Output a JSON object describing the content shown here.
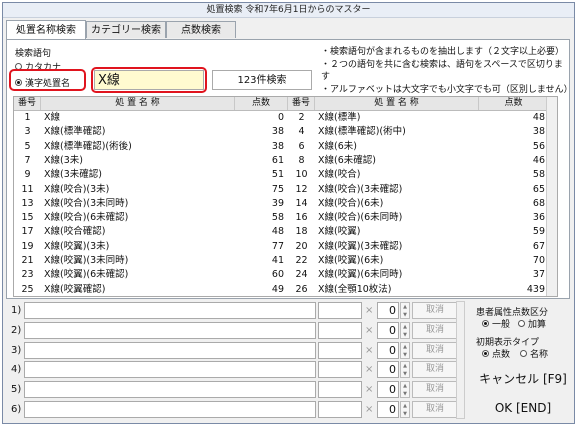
{
  "window": {
    "title": "処置検索 令和7年6月1日からのマスター"
  },
  "tabs": [
    {
      "label": "処置名称検索",
      "active": true
    },
    {
      "label": "カテゴリー検索",
      "active": false
    },
    {
      "label": "点数検索",
      "active": false
    }
  ],
  "search": {
    "group_label": "検索語句",
    "radio_katakana": "カタカナ",
    "radio_kanji": "漢字処置名",
    "query": "X線",
    "result_button": "123件検索"
  },
  "notes": [
    "・検索語句が含まれるものを抽出します（２文字以上必要）",
    "・２つの語句を共に含む検索は、語句をスペースで区切ります",
    "・アルファベットは大文字でも小文字でも可（区別しません）"
  ],
  "grid": {
    "headers": [
      "番号",
      "処 置 名 称",
      "点数",
      "番号",
      "処 置 名 称",
      "点数"
    ],
    "rows": [
      {
        "n1": "1",
        "name1": "X線",
        "p1": "0",
        "n2": "2",
        "name2": "X線(標準)",
        "p2": "48"
      },
      {
        "n1": "3",
        "name1": "X線(標準確認)",
        "p1": "38",
        "n2": "4",
        "name2": "X線(標準確認)(術中)",
        "p2": "38"
      },
      {
        "n1": "5",
        "name1": "X線(標準確認)(術後)",
        "p1": "38",
        "n2": "6",
        "name2": "X線(6未)",
        "p2": "56"
      },
      {
        "n1": "7",
        "name1": "X線(3未)",
        "p1": "61",
        "n2": "8",
        "name2": "X線(6未確認)",
        "p2": "46"
      },
      {
        "n1": "9",
        "name1": "X線(3未確認)",
        "p1": "51",
        "n2": "10",
        "name2": "X線(咬合)",
        "p2": "58"
      },
      {
        "n1": "11",
        "name1": "X線(咬合)(3未)",
        "p1": "75",
        "n2": "12",
        "name2": "X線(咬合)(3未確認)",
        "p2": "65"
      },
      {
        "n1": "13",
        "name1": "X線(咬合)(3未同時)",
        "p1": "39",
        "n2": "14",
        "name2": "X線(咬合)(6未)",
        "p2": "68"
      },
      {
        "n1": "15",
        "name1": "X線(咬合)(6未確認)",
        "p1": "58",
        "n2": "16",
        "name2": "X線(咬合)(6未同時)",
        "p2": "36"
      },
      {
        "n1": "17",
        "name1": "X線(咬合確認)",
        "p1": "48",
        "n2": "18",
        "name2": "X線(咬翼)",
        "p2": "59"
      },
      {
        "n1": "19",
        "name1": "X線(咬翼)(3未)",
        "p1": "77",
        "n2": "20",
        "name2": "X線(咬翼)(3未確認)",
        "p2": "67"
      },
      {
        "n1": "21",
        "name1": "X線(咬翼)(3未同時)",
        "p1": "41",
        "n2": "22",
        "name2": "X線(咬翼)(6未)",
        "p2": "70"
      },
      {
        "n1": "23",
        "name1": "X線(咬翼)(6未確認)",
        "p1": "60",
        "n2": "24",
        "name2": "X線(咬翼)(6未同時)",
        "p2": "37"
      },
      {
        "n1": "25",
        "name1": "X線(咬翼確認)",
        "p1": "49",
        "n2": "26",
        "name2": "X線(全顎10枚法)",
        "p2": "439"
      }
    ]
  },
  "entries": [
    {
      "num": "1)",
      "qty": "0",
      "delete": "取消"
    },
    {
      "num": "2)",
      "qty": "0",
      "delete": "取消"
    },
    {
      "num": "3)",
      "qty": "0",
      "delete": "取消"
    },
    {
      "num": "4)",
      "qty": "0",
      "delete": "取消"
    },
    {
      "num": "5)",
      "qty": "0",
      "delete": "取消"
    },
    {
      "num": "6)",
      "qty": "0",
      "delete": "取消"
    }
  ],
  "entry_x": "×",
  "right_panel": {
    "attr_label": "患者属性点数区分",
    "attr_general": "一般",
    "attr_add": "加算",
    "display_label": "初期表示タイプ",
    "display_points": "点数",
    "display_name": "名称",
    "cancel_button": "キャンセル [F9]",
    "ok_button": "OK [END]"
  }
}
